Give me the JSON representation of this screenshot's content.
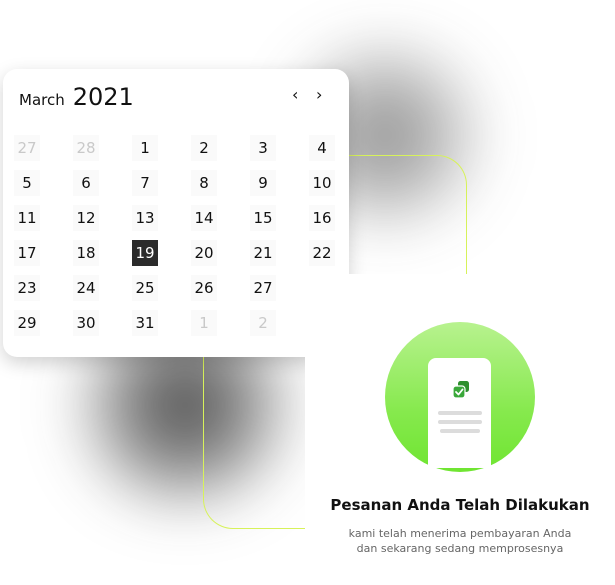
{
  "calendar": {
    "month": "March",
    "year": "2021",
    "prev_icon": "chevron-left-icon",
    "next_icon": "chevron-right-icon",
    "days": [
      {
        "label": "27",
        "muted": true
      },
      {
        "label": "28",
        "muted": true
      },
      {
        "label": "1"
      },
      {
        "label": "2"
      },
      {
        "label": "3"
      },
      {
        "label": "4"
      },
      {
        "label": "5"
      },
      {
        "label": "6"
      },
      {
        "label": "7"
      },
      {
        "label": "8"
      },
      {
        "label": "9"
      },
      {
        "label": "10"
      },
      {
        "label": "11"
      },
      {
        "label": "12"
      },
      {
        "label": "13"
      },
      {
        "label": "14"
      },
      {
        "label": "15"
      },
      {
        "label": "16"
      },
      {
        "label": "17"
      },
      {
        "label": "18"
      },
      {
        "label": "19",
        "selected": true
      },
      {
        "label": "20"
      },
      {
        "label": "21"
      },
      {
        "label": "22"
      },
      {
        "label": "23"
      },
      {
        "label": "24"
      },
      {
        "label": "25"
      },
      {
        "label": "26"
      },
      {
        "label": "27"
      },
      {
        "label": ""
      },
      {
        "label": "29"
      },
      {
        "label": "30"
      },
      {
        "label": "31"
      },
      {
        "label": "1",
        "muted": true
      },
      {
        "label": "2",
        "muted": true
      },
      {
        "label": ""
      }
    ],
    "selected_bg": "#2b2b2b"
  },
  "order": {
    "icon": "copy-check-icon",
    "title": "Pesanan Anda Telah Dilakukan",
    "subtitle_line1": "kami telah menerima pembayaran Anda",
    "subtitle_line2": "dan sekarang sedang memprosesnya"
  },
  "colors": {
    "accent_green": "#6fe531",
    "connector": "#d7f25a"
  }
}
